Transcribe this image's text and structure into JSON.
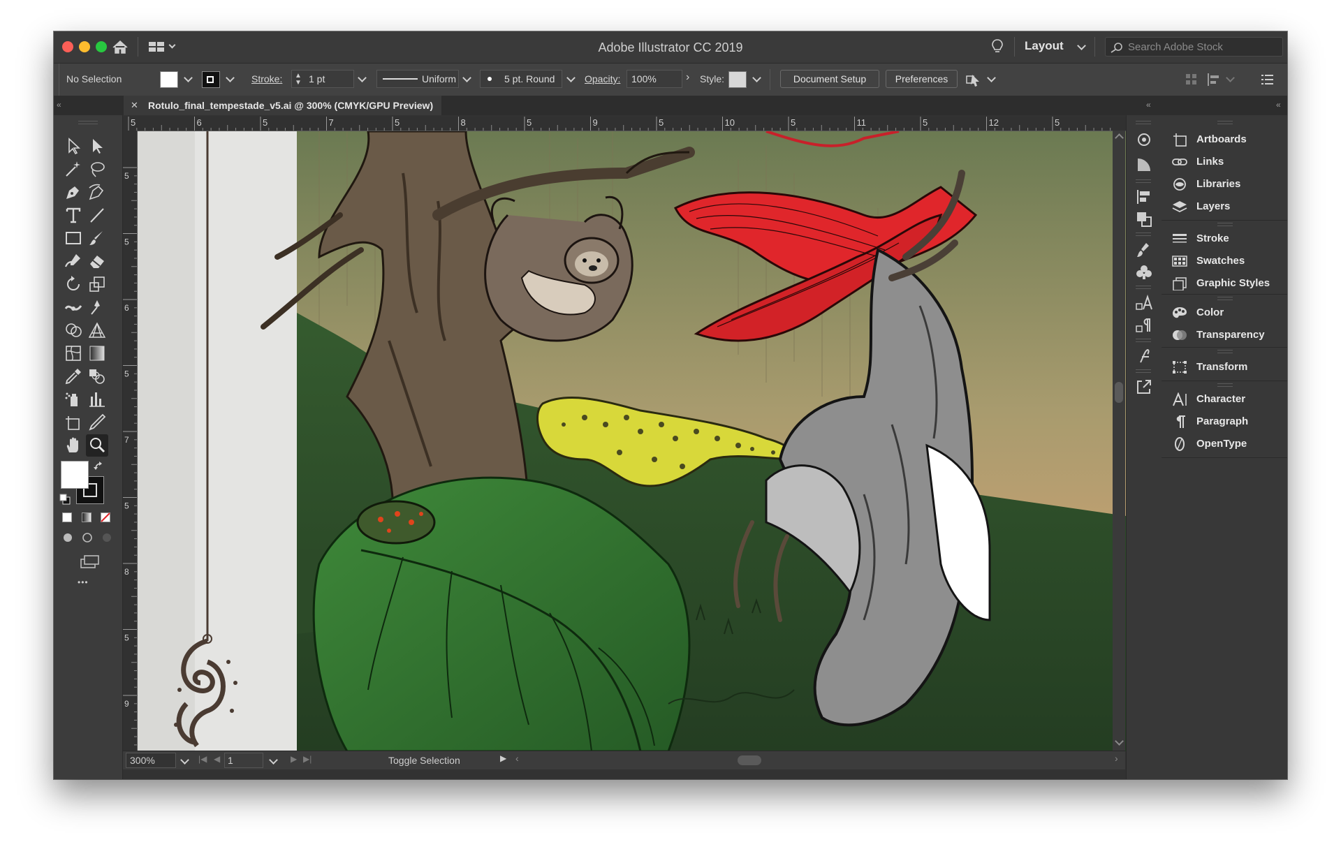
{
  "app": {
    "title": "Adobe Illustrator CC 2019",
    "workspace_label": "Layout",
    "search_placeholder": "Search Adobe Stock"
  },
  "control_bar": {
    "selection_label": "No Selection",
    "stroke_label": "Stroke:",
    "stroke_weight": "1 pt",
    "profile": "Uniform",
    "brush": "5 pt. Round",
    "opacity_label": "Opacity:",
    "opacity_value": "100%",
    "style_label": "Style:",
    "document_setup_label": "Document Setup",
    "preferences_label": "Preferences"
  },
  "document_tab": {
    "close_glyph": "✕",
    "title": "Rotulo_final_tempestade_v5.ai @ 300% (CMYK/GPU Preview)"
  },
  "ruler": {
    "horizontal_labels": [
      "5",
      "6",
      "5",
      "7",
      "5",
      "8",
      "5",
      "9",
      "5",
      "10",
      "5",
      "11",
      "5",
      "12",
      "5"
    ],
    "vertical_labels": [
      "5",
      "5",
      "6",
      "5",
      "7",
      "5",
      "8",
      "5",
      "9"
    ]
  },
  "status_bar": {
    "zoom": "300%",
    "artboard_number": "1",
    "status_text": "Toggle Selection"
  },
  "toolbar": {
    "more_glyph": "•••"
  },
  "panels": {
    "groups": [
      [
        {
          "label": "Artboards",
          "icon": "artboards-icon"
        },
        {
          "label": "Links",
          "icon": "links-icon"
        },
        {
          "label": "Libraries",
          "icon": "libraries-icon"
        },
        {
          "label": "Layers",
          "icon": "layers-icon"
        }
      ],
      [
        {
          "label": "Stroke",
          "icon": "stroke-icon"
        },
        {
          "label": "Swatches",
          "icon": "swatches-icon"
        },
        {
          "label": "Graphic Styles",
          "icon": "graphic-styles-icon"
        }
      ],
      [
        {
          "label": "Color",
          "icon": "color-icon"
        },
        {
          "label": "Transparency",
          "icon": "transparency-icon"
        }
      ],
      [
        {
          "label": "Transform",
          "icon": "transform-icon"
        }
      ],
      [
        {
          "label": "Character",
          "icon": "character-icon"
        },
        {
          "label": "Paragraph",
          "icon": "paragraph-icon"
        },
        {
          "label": "OpenType",
          "icon": "opentype-icon"
        }
      ]
    ]
  },
  "colors": {
    "ui_dark": "#323232",
    "panel_bg": "#383838",
    "accent_red": "#e0262b",
    "jungle_green": "#2f5a2c",
    "leopard_yellow": "#d8d83a"
  }
}
